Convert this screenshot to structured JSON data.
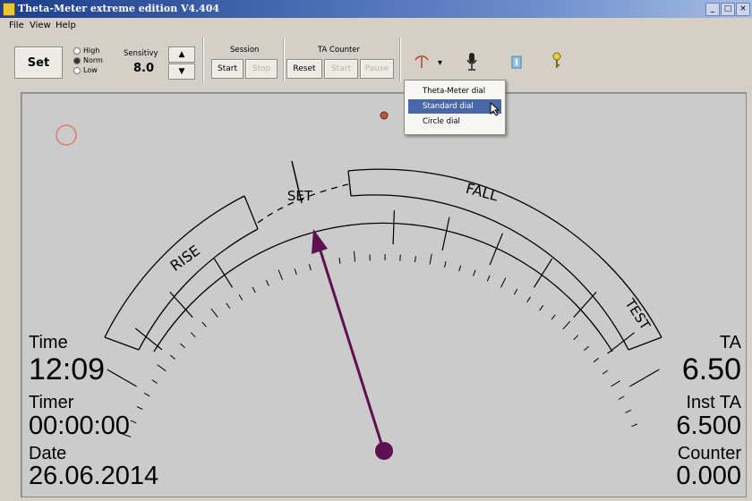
{
  "window": {
    "title": "Theta-Meter extreme edition V4.404"
  },
  "menubar": {
    "file": "File",
    "view": "View",
    "help": "Help"
  },
  "toolbar": {
    "set": "Set",
    "radios": {
      "high": "High",
      "norm": "Norm",
      "low": "Low",
      "selected": "norm"
    },
    "sensitivity": {
      "label": "Sensitivy",
      "value": "8.0"
    },
    "session": {
      "label": "Session",
      "start": "Start",
      "stop": "Stop"
    },
    "ta_counter": {
      "label": "TA Counter",
      "reset": "Reset",
      "start": "Start",
      "pause": "Pause"
    },
    "icons": [
      "dial-type-icon",
      "dropdown-arrow-icon",
      "microphone-icon",
      "info-icon",
      "key-icon"
    ]
  },
  "dial_menu": {
    "items": [
      "Theta-Meter dial",
      "Standard dial",
      "Circle dial"
    ],
    "selected": "Standard dial"
  },
  "dial": {
    "labels": {
      "rise": "RISE",
      "set": "SET",
      "fall": "FALL",
      "test": "TEST"
    },
    "needle_color": "#5e1150"
  },
  "readouts": {
    "time_label": "Time",
    "time": "12:09",
    "timer_label": "Timer",
    "timer": "00:00:00",
    "date_label": "Date",
    "date": "26.06.2014",
    "ta_label": "TA",
    "ta": "6.50",
    "inst_ta_label": "Inst TA",
    "inst_ta": "6.500",
    "counter_label": "Counter",
    "counter": "0.000"
  }
}
